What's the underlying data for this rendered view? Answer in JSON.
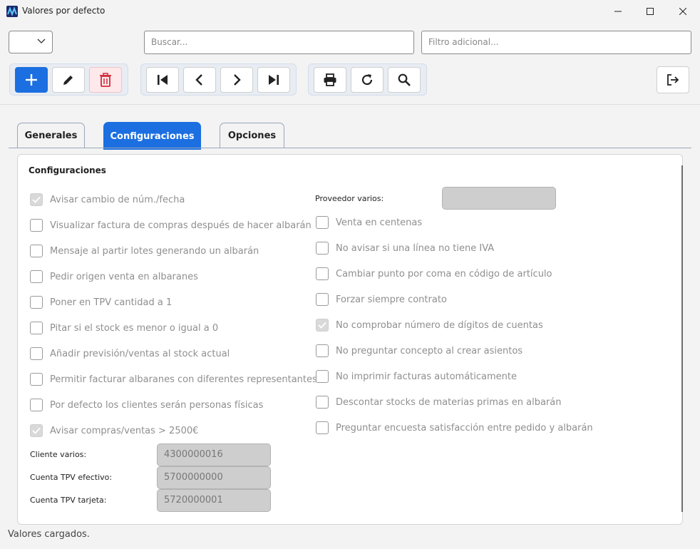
{
  "window": {
    "title": "Valores por defecto"
  },
  "search": {
    "placeholder": "Buscar...",
    "filter_placeholder": "Filtro adicional..."
  },
  "tabs": [
    {
      "label": "Generales"
    },
    {
      "label": "Configuraciones"
    },
    {
      "label": "Opciones"
    }
  ],
  "panel": {
    "title": "Configuraciones",
    "left_checkboxes": [
      {
        "label": "Avisar cambio de núm./fecha",
        "checked": true
      },
      {
        "label": "Visualizar factura de compras después de hacer albarán",
        "checked": false
      },
      {
        "label": "Mensaje al partir lotes generando un albarán",
        "checked": false
      },
      {
        "label": "Pedir origen venta en albaranes",
        "checked": false
      },
      {
        "label": "Poner en TPV cantidad a 1",
        "checked": false
      },
      {
        "label": "Pitar si el stock es menor o igual a 0",
        "checked": false
      },
      {
        "label": "Añadir previsión/ventas al stock actual",
        "checked": false
      },
      {
        "label": "Permitir facturar albaranes con diferentes representantes",
        "checked": false
      },
      {
        "label": "Por defecto los clientes serán personas físicas",
        "checked": false
      },
      {
        "label": "Avisar compras/ventas > 2500€",
        "checked": true
      }
    ],
    "right_checkboxes": [
      {
        "label": "Venta en centenas",
        "checked": false
      },
      {
        "label": "No avisar si una línea no tiene IVA",
        "checked": false
      },
      {
        "label": "Cambiar punto por coma en código de artículo",
        "checked": false
      },
      {
        "label": "Forzar siempre contrato",
        "checked": false
      },
      {
        "label": "No comprobar número de dígitos de cuentas",
        "checked": true
      },
      {
        "label": "No preguntar concepto al crear asientos",
        "checked": false
      },
      {
        "label": "No imprimir facturas automáticamente",
        "checked": false
      },
      {
        "label": "Descontar stocks de materias primas en albarán",
        "checked": false
      },
      {
        "label": "Preguntar encuesta satisfacción entre pedido y albarán",
        "checked": false
      }
    ],
    "proveedor": {
      "label": "Proveedor varios:",
      "value": ""
    },
    "fields": [
      {
        "label": "Cliente varios:",
        "value": "4300000016"
      },
      {
        "label": "Cuenta TPV efectivo:",
        "value": "5700000000"
      },
      {
        "label": "Cuenta TPV tarjeta:",
        "value": "5720000001"
      }
    ]
  },
  "status": "Valores cargados.",
  "colors": {
    "accent": "#1b6fe0",
    "delete": "#d12a3a"
  }
}
